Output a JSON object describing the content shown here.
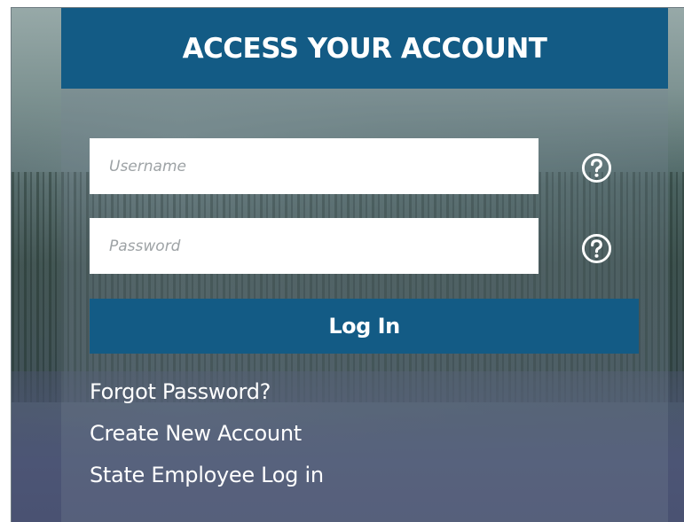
{
  "header": {
    "title": "ACCESS YOUR ACCOUNT"
  },
  "form": {
    "username": {
      "value": "",
      "placeholder": "Username",
      "help_icon": "question-circle-icon"
    },
    "password": {
      "value": "",
      "placeholder": "Password",
      "help_icon": "question-circle-icon"
    },
    "login_label": "Log In"
  },
  "links": {
    "forgot_password": "Forgot Password?",
    "create_account": "Create New Account",
    "state_employee": "State Employee Log in"
  },
  "colors": {
    "primary": "#135b85",
    "text_light": "#ffffff",
    "placeholder": "#9ea3a6"
  }
}
